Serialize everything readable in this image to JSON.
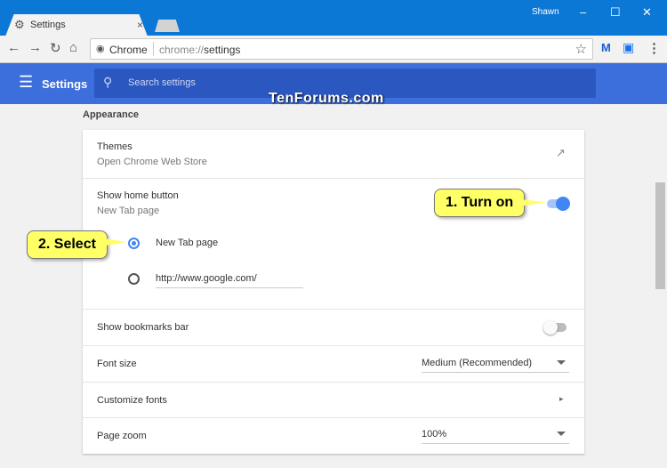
{
  "window": {
    "user": "Shawn",
    "minimize": "–",
    "maximize": "☐",
    "close": "✕"
  },
  "tab": {
    "title": "Settings",
    "close": "×"
  },
  "omnibox": {
    "site": "Chrome",
    "url_prefix": "chrome://",
    "url_path": "settings"
  },
  "header": {
    "title": "Settings",
    "search_placeholder": "Search settings"
  },
  "watermark": "TenForums.com",
  "section": "Appearance",
  "themes": {
    "label": "Themes",
    "sub": "Open Chrome Web Store"
  },
  "home": {
    "label": "Show home button",
    "sub": "New Tab page",
    "enabled": true,
    "options": [
      {
        "label": "New Tab page",
        "selected": true
      },
      {
        "label": "http://www.google.com/",
        "selected": false
      }
    ]
  },
  "bookmarks": {
    "label": "Show bookmarks bar",
    "enabled": false
  },
  "font_size": {
    "label": "Font size",
    "value": "Medium (Recommended)"
  },
  "custom_fonts": {
    "label": "Customize fonts"
  },
  "page_zoom": {
    "label": "Page zoom",
    "value": "100%"
  },
  "callouts": {
    "one": "1. Turn on",
    "two": "2. Select"
  },
  "colors": {
    "accent": "#4285f4",
    "titlebar": "#0a78d4",
    "header": "#3d6fdc"
  }
}
